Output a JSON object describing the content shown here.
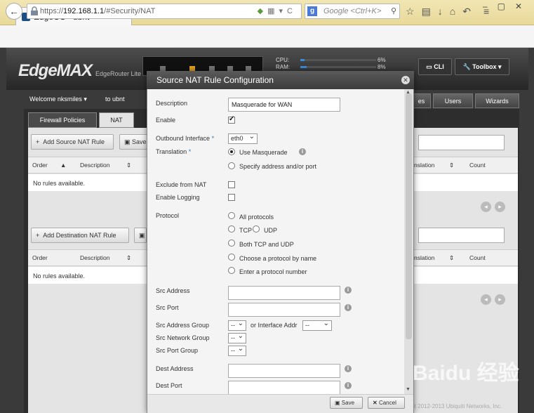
{
  "browser": {
    "tab_title": "EdgeOS - ubnt",
    "new_tab": "+",
    "url_prefix": "https://",
    "url_host": "192.168.1.1",
    "url_path": "/#Security/NAT",
    "search_placeholder": "Google <Ctrl+K>",
    "search_engine_glyph": "g"
  },
  "app": {
    "logo": "EdgeMAX",
    "router_label": "EdgeRouter Lite",
    "cpu_label": "CPU:",
    "ram_label": "RAM:",
    "cpu_value": "6%",
    "ram_value": "8%",
    "cpu_fraction": 0.06,
    "ram_fraction": 0.08,
    "cli_label": "CLI",
    "toolbox_label": "Toolbox",
    "welcome": "Welcome nksmiles",
    "to_host": "to ubnt",
    "main_tabs": [
      "es",
      "Users",
      "Wizards"
    ],
    "sub_tabs": [
      "Firewall Policies",
      "NAT"
    ],
    "add_source_btn": "Add Source NAT Rule",
    "save_btn_partial": "Save",
    "add_dest_btn": "Add Destination NAT Rule",
    "columns": {
      "order": "Order",
      "description": "Description",
      "translation": "nslation",
      "count": "Count"
    },
    "no_rules": "No rules available.",
    "copyright": "ight 2012-2013 Ubiquiti Networks, Inc."
  },
  "modal": {
    "title": "Source NAT Rule Configuration",
    "description_label": "Description",
    "description_value": "Masquerade for WAN",
    "enable_label": "Enable",
    "enable_checked": true,
    "outbound_label": "Outbound Interface",
    "outbound_value": "eth0",
    "translation_label": "Translation",
    "use_masquerade": "Use Masquerade",
    "specify_address": "Specify address and/or port",
    "exclude_label": "Exclude from NAT",
    "logging_label": "Enable Logging",
    "protocol_label": "Protocol",
    "all_protocols": "All protocols",
    "tcp": "TCP",
    "udp": "UDP",
    "both": "Both TCP and UDP",
    "by_name": "Choose a protocol by name",
    "by_number": "Enter a protocol number",
    "src_address": "Src Address",
    "src_port": "Src Port",
    "src_address_group": "Src Address Group",
    "or_interface": "or Interface Addr",
    "src_network_group": "Src Network Group",
    "src_port_group": "Src Port Group",
    "dest_address": "Dest Address",
    "dest_port": "Dest Port",
    "dash_option": "--",
    "save_label": "Save",
    "cancel_label": "Cancel",
    "required_mark": "*"
  },
  "watermark": "Baidu 经验"
}
